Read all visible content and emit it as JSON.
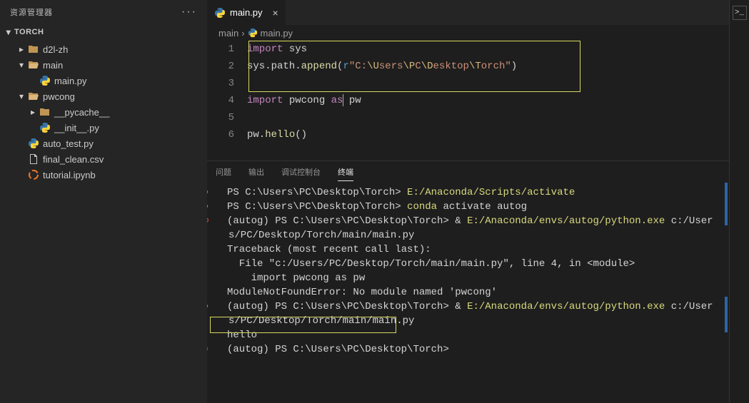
{
  "sidebar": {
    "title": "资源管理器",
    "project": "TORCH",
    "items": [
      {
        "label": "d2l-zh",
        "icon": "folder",
        "indent": 1,
        "twisty": "right"
      },
      {
        "label": "main",
        "icon": "folder-open",
        "indent": 1,
        "twisty": "down"
      },
      {
        "label": "main.py",
        "icon": "python",
        "indent": 2,
        "twisty": "blank"
      },
      {
        "label": "pwcong",
        "icon": "folder-open",
        "indent": 1,
        "twisty": "down"
      },
      {
        "label": "__pycache__",
        "icon": "folder",
        "indent": 2,
        "twisty": "right"
      },
      {
        "label": "__init__.py",
        "icon": "python",
        "indent": 2,
        "twisty": "blank"
      },
      {
        "label": "auto_test.py",
        "icon": "python",
        "indent": 1,
        "twisty": "blank"
      },
      {
        "label": "final_clean.csv",
        "icon": "file",
        "indent": 1,
        "twisty": "blank"
      },
      {
        "label": "tutorial.ipynb",
        "icon": "jupyter",
        "indent": 1,
        "twisty": "blank"
      }
    ]
  },
  "tab": {
    "label": "main.py"
  },
  "breadcrumb": {
    "seg1": "main",
    "seg2": "main.py"
  },
  "code": {
    "lines": [
      "1",
      "2",
      "3",
      "4",
      "5",
      "6"
    ],
    "line1_kw": "import",
    "line1_mod": " sys",
    "line2_a": "sys.path.",
    "line2_fn": "append",
    "line2_b": "(",
    "line2_r": "r",
    "line2_str1": "\"C:",
    "line2_e1": "\\U",
    "line2_s2": "sers",
    "line2_e2": "\\P",
    "line2_s3": "C",
    "line2_e3": "\\D",
    "line2_s4": "esktop",
    "line2_e4": "\\T",
    "line2_s5": "orch\"",
    "line2_c": ")",
    "line4_kw": "import",
    "line4_mod": " pwcong ",
    "line4_as": "as",
    "line4_alias": " pw",
    "line6_a": "pw.",
    "line6_fn": "hello",
    "line6_b": "()"
  },
  "panel_tabs": {
    "t1": "问题",
    "t2": "输出",
    "t3": "调试控制台",
    "t4": "终端"
  },
  "terminal": {
    "l1a": "PS C:\\Users\\PC\\Desktop\\Torch> ",
    "l1b": "E:/Anaconda/Scripts/activate",
    "l2a": "PS C:\\Users\\PC\\Desktop\\Torch> ",
    "l2b": "conda",
    "l2c": " activate autog",
    "l3a": "(autog) PS C:\\Users\\PC\\Desktop\\Torch> & ",
    "l3b": "E:/Anaconda/envs/autog/python.exe",
    "l3c": " c:/Users/PC/Desktop/Torch/main/main.py",
    "l4": "Traceback (most recent call last):",
    "l5": "  File \"c:/Users/PC/Desktop/Torch/main/main.py\", line 4, in <module>",
    "l6": "    import pwcong as pw",
    "l7": "ModuleNotFoundError: No module named 'pwcong'",
    "l8a": "(autog) PS C:\\Users\\PC\\Desktop\\Torch> & ",
    "l8b": "E:/Anaconda/envs/autog/python.exe",
    "l8c": " c:/Users/PC/Desktop/Torch/main/main.py",
    "l9": "hello",
    "l10": "(autog) PS C:\\Users\\PC\\Desktop\\Torch>"
  }
}
